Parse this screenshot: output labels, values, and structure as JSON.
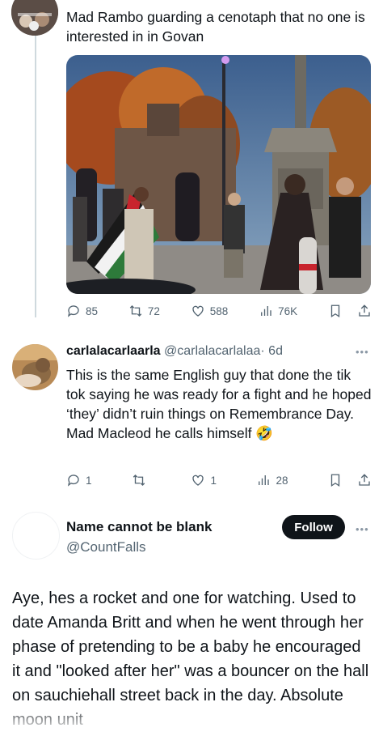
{
  "tweet1": {
    "text": "Mad Rambo guarding a cenotaph that no one is interested in in Govan",
    "stats": {
      "replies": "85",
      "retweets": "72",
      "likes": "588",
      "views": "76K"
    }
  },
  "reply": {
    "name": "carlalacarlaarla",
    "handle": "@carlalacarlalaa",
    "time": "· 6d",
    "text": "This is the same English guy that done the tik tok saying he was ready for a fight and he hoped ‘they’ didn’t ruin things on Remembrance Day. Mad Macleod he calls himself 🤣",
    "stats": {
      "replies": "1",
      "retweets": "",
      "likes": "1",
      "views": "28"
    }
  },
  "profile": {
    "name": "Name cannot be blank",
    "handle": "@CountFalls",
    "follow_label": "Follow"
  },
  "post": {
    "text": "Aye, hes a rocket and one for watching. Used to date Amanda Britt and when he went through her phase of pretending to be a baby he encouraged it and \"looked after her\" was a bouncer on the hall on sauchiehall street back in the day. Absolute moon unit"
  },
  "icons": {
    "reply": "reply-icon",
    "retweet": "retweet-icon",
    "like": "heart-icon",
    "views": "views-icon",
    "bookmark": "bookmark-icon",
    "share": "share-icon",
    "more": "more-icon"
  }
}
